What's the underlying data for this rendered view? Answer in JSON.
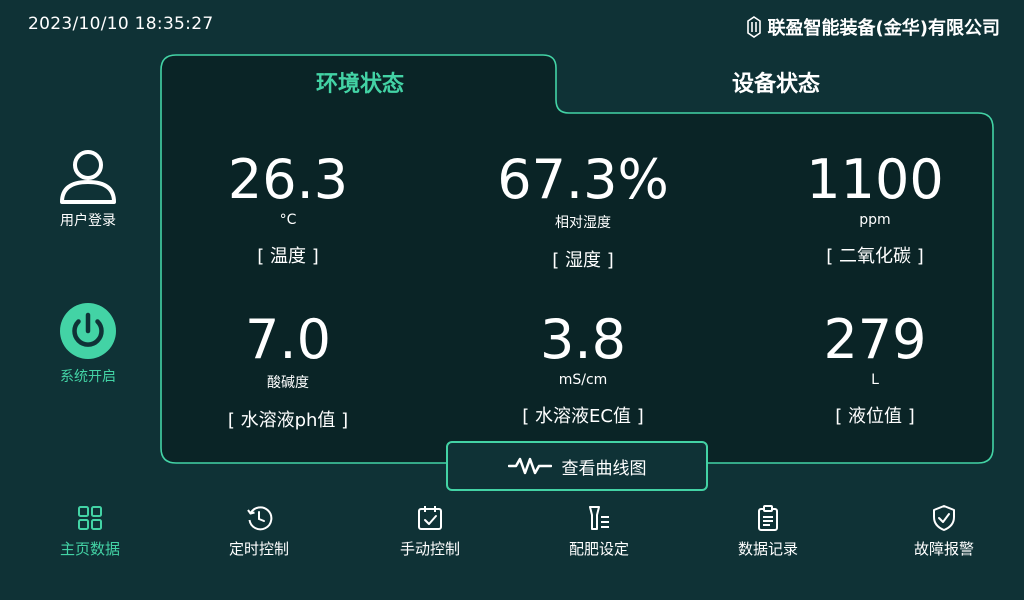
{
  "header": {
    "datetime": "2023/10/10  18:35:27",
    "brand": "联盈智能装备(金华)有限公司"
  },
  "sidebar": {
    "user_login": "用户登录",
    "system_power": "系统开启"
  },
  "tabs": {
    "environment": "环境状态",
    "device": "设备状态"
  },
  "metrics": {
    "temperature": {
      "value": "26.3",
      "unit": "°C",
      "label": "[ 温度 ]"
    },
    "humidity": {
      "value": "67.3%",
      "unit": "相对湿度",
      "label": "[ 湿度 ]"
    },
    "co2": {
      "value": "1100",
      "unit": "ppm",
      "label": "[ 二氧化碳 ]"
    },
    "ph": {
      "value": "7.0",
      "unit": "酸碱度",
      "label": "[ 水溶液ph值 ]"
    },
    "ec": {
      "value": "3.8",
      "unit": "mS/cm",
      "label": "[ 水溶液EC值 ]"
    },
    "level": {
      "value": "279",
      "unit": "L",
      "label": "[ 液位值 ]"
    }
  },
  "curve_button": "查看曲线图",
  "nav": {
    "home": "主页数据",
    "timer": "定时控制",
    "manual": "手动控制",
    "fertilizer": "配肥设定",
    "records": "数据记录",
    "alarm": "故障报警"
  },
  "colors": {
    "background": "#0f3236",
    "panel": "#0a2426",
    "accent": "#43d3a5"
  }
}
